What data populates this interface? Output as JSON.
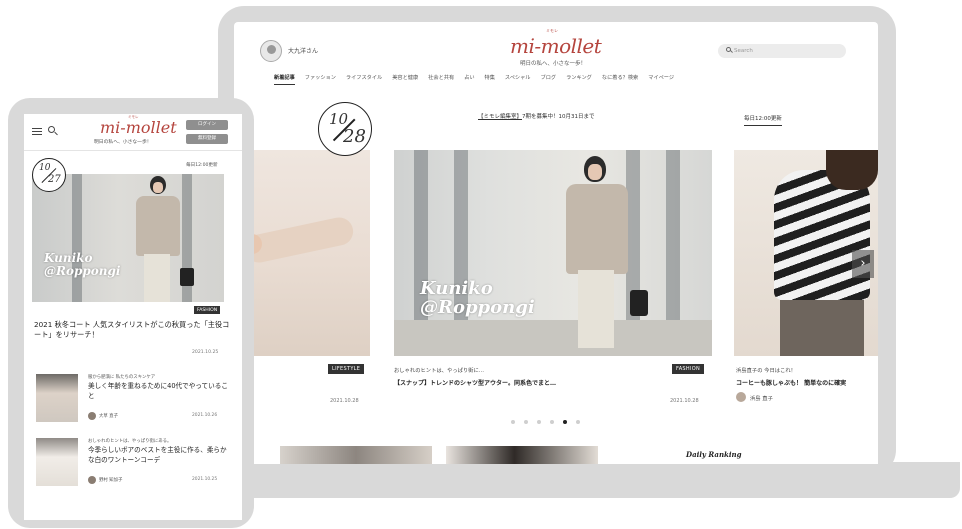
{
  "desktop": {
    "header": {
      "user_name": "大九洋さん",
      "logo": "mi-mollet",
      "logo_ruby": "ミモレ",
      "tagline": "明日の私へ、小さな一歩！",
      "search_placeholder": "Search"
    },
    "nav": [
      {
        "label": "新着記事",
        "active": true
      },
      {
        "label": "ファッション"
      },
      {
        "label": "ライフスタイル"
      },
      {
        "label": "美容と健康"
      },
      {
        "label": "社会と共有"
      },
      {
        "label": "占い"
      },
      {
        "label": "特集"
      },
      {
        "label": "スペシャル"
      },
      {
        "label": "ブログ"
      },
      {
        "label": "ランキング"
      },
      {
        "label": "なに着る？検索"
      },
      {
        "label": "マイページ"
      }
    ],
    "date_badge": {
      "month": "10",
      "day": "28"
    },
    "notice": {
      "link": "【ミモレ編集室】",
      "text": "7期を募集中！10月31日まで"
    },
    "update_note": "毎日12:00更新",
    "slides": {
      "prev": {
        "tag": "LIFESTYLE",
        "date": "2021.10.28"
      },
      "main": {
        "overlay_line1": "Kuniko",
        "overlay_line2": "@Roppongi",
        "kicker": "おしゃれのヒントは、やっぱり街に…",
        "headline": "【スナップ】トレンドのシャツ型アウター。同系色でまと…",
        "tag": "FASHION",
        "date": "2021.10.28"
      },
      "next": {
        "kicker": "浜島直子の 今日はこれ！",
        "headline": "コーヒーも豚しゃぶも！ 簡単なのに確実",
        "author": "浜島 直子"
      },
      "next_arrow": "›"
    },
    "ranking_title": "Daily Ranking"
  },
  "mobile": {
    "logo": "mi-mollet",
    "logo_ruby": "ミモレ",
    "tagline": "明日の私へ、小さな一歩！",
    "login_button": "ログイン",
    "register_button": "無料登録",
    "update_note": "毎日12:00更新",
    "date_badge": {
      "month": "10",
      "day": "27"
    },
    "hero_overlay_line1": "Kuniko",
    "hero_overlay_line2": "@Roppongi",
    "hero_tag": "FASHION",
    "hero_title": "2021 秋冬コート 人気スタイリストがこの秋買った「主役コート」をリサーチ！",
    "hero_date": "2021.10.25",
    "items": [
      {
        "kicker": "服から肥満に 私たちのスキンケア",
        "title": "美しく年齢を重ねるために40代でやっていること",
        "author": "大草 直子",
        "date": "2021.10.26"
      },
      {
        "kicker": "おしゃれのヒントは、やっぱり街にある。",
        "title": "今季らしいボアのベストを主役に作る、柔らかな白のワントーンコーデ",
        "author": "野村 知加子",
        "date": "2021.10.25"
      }
    ]
  }
}
